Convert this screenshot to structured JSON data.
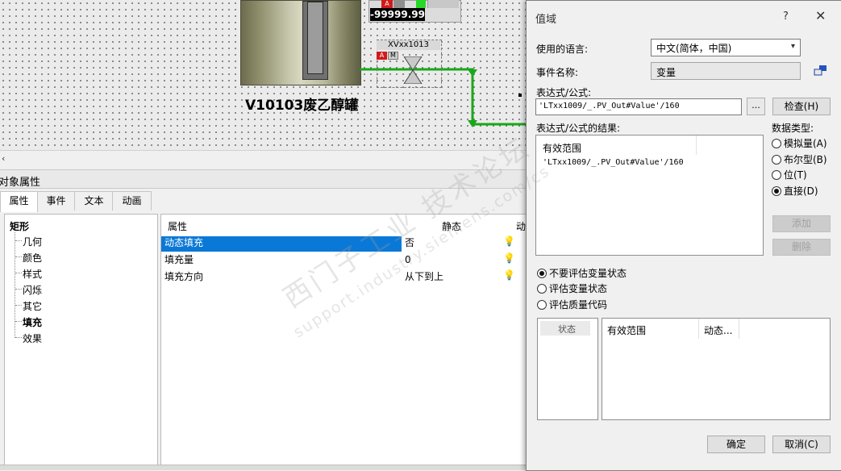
{
  "canvas": {
    "tank_label": "V10103废乙醇罐",
    "display_value": "-99999.99",
    "ribbon_a": "A",
    "valve_tag": "XVxx1013",
    "valve_a": "A",
    "valve_m": "M",
    "scroll_left": "‹"
  },
  "props": {
    "title": "对象属性",
    "tabs": [
      "属性",
      "事件",
      "文本",
      "动画"
    ],
    "tree_root": "矩形",
    "tree_items": [
      "几何",
      "颜色",
      "样式",
      "闪烁",
      "其它",
      "填充",
      "效果"
    ],
    "tree_selected": "填充",
    "columns": [
      "属性",
      "静态",
      "动态"
    ],
    "rows": [
      {
        "name": "动态填充",
        "static": "否"
      },
      {
        "name": "填充量",
        "static": "0"
      },
      {
        "name": "填充方向",
        "static": "从下到上"
      }
    ]
  },
  "dialog": {
    "title": "值域",
    "help": "?",
    "close": "✕",
    "language_label": "使用的语言:",
    "language_value": "中文(简体，中国)",
    "event_label": "事件名称:",
    "event_value": "变量",
    "expr_label": "表达式/公式:",
    "expr_value": "'LTxx1009/_.PV_Out#Value'/160",
    "browse_label": "...",
    "check_button": "检查(H)",
    "result_label": "表达式/公式的结果:",
    "result_col": "有效范围",
    "result_value": "'LTxx1009/_.PV_Out#Value'/160",
    "data_type_label": "数据类型:",
    "data_types": [
      "模拟量(A)",
      "布尔型(B)",
      "位(T)",
      "直接(D)"
    ],
    "data_type_selected": "直接(D)",
    "add_button": "添加",
    "delete_button": "删除",
    "eval_options": [
      "不要评估变量状态",
      "评估变量状态",
      "评估质量代码"
    ],
    "eval_selected": "不要评估变量状态",
    "status_col": "状态",
    "range_cols": [
      "有效范围",
      "动态..."
    ],
    "ok_button": "确定",
    "cancel_button": "取消(C)"
  },
  "watermark": {
    "line1": "西门子工业 技术论坛",
    "line2": "support.industry.siemens.com/cs"
  },
  "colors": {
    "selection": "#0a78d7",
    "pipe": "#18a818",
    "alarm_red": "#d21a1a"
  }
}
